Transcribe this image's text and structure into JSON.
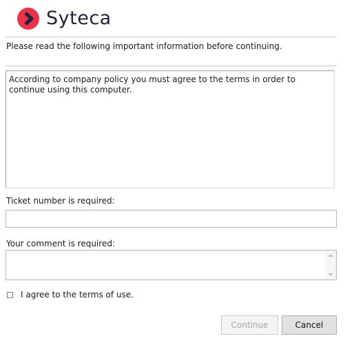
{
  "app": {
    "brand": "Syteca",
    "brand_color": "#e8334a",
    "text_color": "#22223b"
  },
  "intro_text": "Please read the following important information before continuing.",
  "policy_text": "According to company policy you must agree to the terms in order to\ncontinue using this computer.",
  "ticket": {
    "label": "Ticket number is required:",
    "value": ""
  },
  "comment": {
    "label": "Your comment is required:",
    "value": ""
  },
  "agree": {
    "label": "I agree to the terms of use.",
    "checked": false
  },
  "buttons": {
    "continue": "Continue",
    "cancel": "Cancel",
    "continue_enabled": false
  }
}
